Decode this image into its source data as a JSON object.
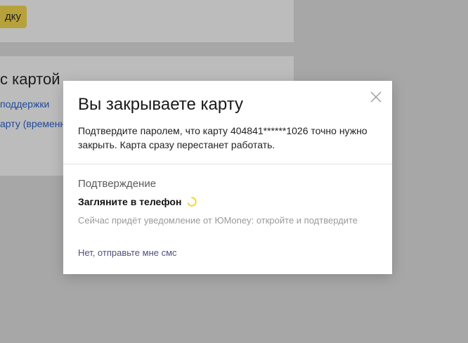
{
  "background": {
    "button_label": "дку",
    "section_heading": "с картой",
    "links": [
      "поддержки",
      "арту (временно"
    ]
  },
  "modal": {
    "title": "Вы закрываете карту",
    "description": "Подтвердите паролем, что карту 404841******1026 точно нужно закрыть. Карта сразу перестанет работать.",
    "section_title": "Подтверждение",
    "check_title": "Загляните в телефон",
    "hint": "Сейчас придёт уведомление от ЮMoney: откройте и подтвердите",
    "sms_link": "Нет, отправьте мне смс"
  },
  "icons": {
    "close": "close-icon",
    "spinner": "loading-spinner-icon"
  },
  "colors": {
    "overlay": "#a7a7a7",
    "modal_bg": "#ffffff",
    "spinner": "#f5d31c",
    "link": "#4f4f7e",
    "hint": "#9a9a9a"
  }
}
